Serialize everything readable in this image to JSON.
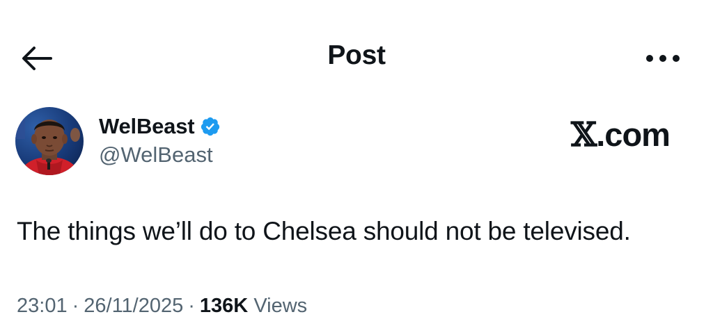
{
  "header": {
    "title": "Post",
    "back_icon": "arrow-left-icon",
    "more_icon": "more-horizontal-icon"
  },
  "author": {
    "display_name": "WelBeast",
    "handle": "@WelBeast",
    "verified": true,
    "badge_color": "#1d9bf0"
  },
  "watermark": {
    "x_mark": "𝕏",
    "suffix": ".com"
  },
  "post": {
    "text": "The things we’ll do to Chelsea should not be televised.",
    "time": "23:01",
    "date": "26/11/2025",
    "separator": "·",
    "views_count": "136K",
    "views_label": "Views"
  },
  "colors": {
    "text_primary": "#0f1419",
    "text_secondary": "#536471",
    "accent": "#1d9bf0",
    "background": "#ffffff"
  }
}
